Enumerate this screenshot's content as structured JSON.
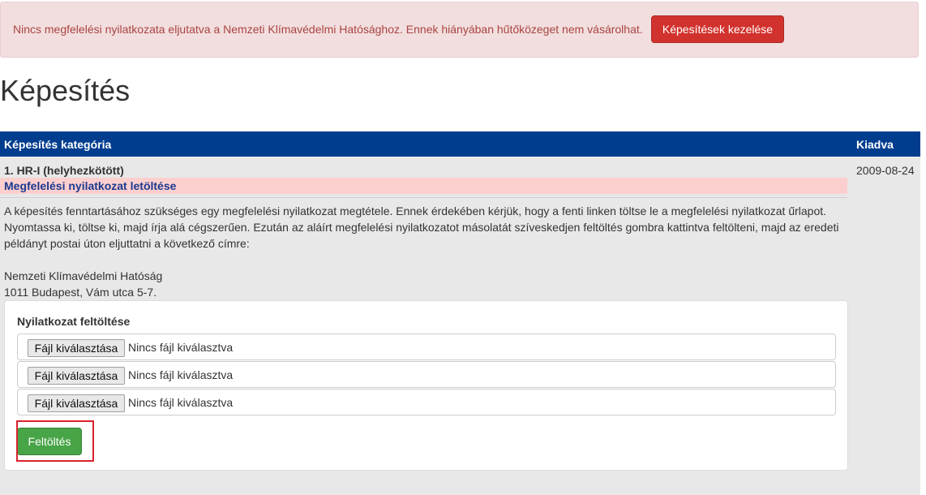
{
  "alert": {
    "message": "Nincs megfelelési nyilatkozata eljutatva a Nemzeti Klímavédelmi Hatósághoz. Ennek hiányában hűtőközeget nem vásárolhat.",
    "button_label": "Képesítések kezelése"
  },
  "page_title": "Képesítés",
  "table": {
    "columns": [
      "Képesítés kategória",
      "Kiadva"
    ],
    "row": {
      "category": "1. HR-I (helyhezkötött)",
      "issued": "2009-08-24",
      "download_link": "Megfelelési nyilatkozat letöltése",
      "description": "A képesítés fenntartásához szükséges egy megfelelési nyilatkozat megtétele. Ennek érdekében kérjük, hogy a fenti linken töltse le a megfelelési nyilatkozat űrlapot. Nyomtassa ki, töltse ki, majd írja alá cégszerűen. Ezután az aláírt megfelelési nyilatkozatot másolatát szíveskedjen feltöltés gombra kattintva feltölteni, majd az eredeti példányt postai úton eljuttatni a következő címre:",
      "address": [
        "Nemzeti Klímavédelmi Hatóság",
        "1011 Budapest, Vám utca 5-7."
      ]
    }
  },
  "upload": {
    "title": "Nyilatkozat feltöltése",
    "files": [
      {
        "button": "Fájl kiválasztása",
        "status": "Nincs fájl kiválasztva"
      },
      {
        "button": "Fájl kiválasztása",
        "status": "Nincs fájl kiválasztva"
      },
      {
        "button": "Fájl kiválasztása",
        "status": "Nincs fájl kiválasztva"
      }
    ],
    "submit_label": "Feltöltés"
  },
  "colors": {
    "alert_bg": "#f2dede",
    "alert_text": "#a94442",
    "danger": "#d2322d",
    "header_blue": "#003d8f",
    "success": "#47a447",
    "highlight": "#d9232d"
  }
}
